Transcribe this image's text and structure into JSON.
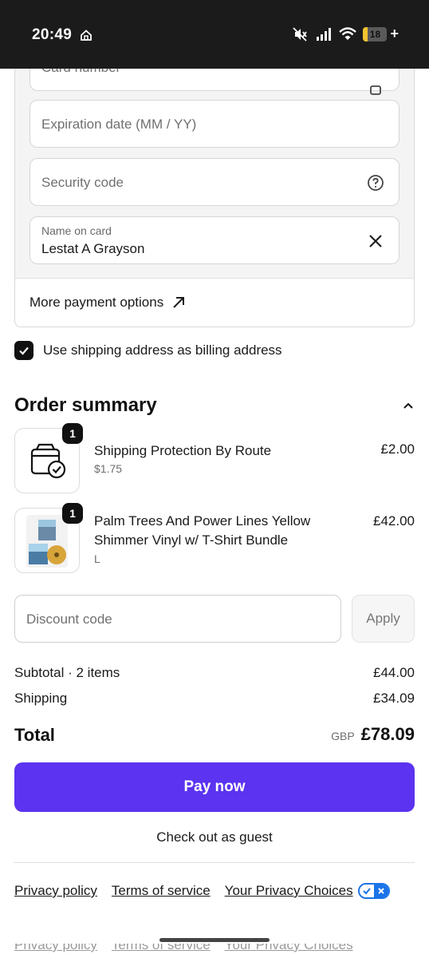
{
  "status_bar": {
    "time": "20:49",
    "battery": "18",
    "battery_level": 0.18,
    "plus": "+",
    "icons": [
      "home-icon",
      "mute-icon",
      "signal-icon",
      "wifi-icon",
      "battery-icon"
    ]
  },
  "card_form": {
    "card_number_placeholder": "Card number",
    "expiration_placeholder": "Expiration date (MM / YY)",
    "security_placeholder": "Security code",
    "name_label": "Name on card",
    "name_value": "Lestat A Grayson",
    "more_payment_options": "More payment options"
  },
  "billing": {
    "checked": true,
    "label": "Use shipping address as billing address"
  },
  "order_summary": {
    "title": "Order summary",
    "items": [
      {
        "qty": "1",
        "name": "Shipping Protection By Route",
        "sub": "$1.75",
        "price": "£2.00"
      },
      {
        "qty": "1",
        "name": "Palm Trees And Power Lines Yellow Shimmer Vinyl w/ T-Shirt Bundle",
        "sub": "L",
        "price": "£42.00"
      }
    ],
    "discount_placeholder": "Discount code",
    "apply_label": "Apply",
    "subtotal_label": "Subtotal · 2 items",
    "subtotal_value": "£44.00",
    "shipping_label": "Shipping",
    "shipping_value": "£34.09",
    "total_label": "Total",
    "total_currency": "GBP",
    "total_value": "£78.09"
  },
  "actions": {
    "pay_now": "Pay now",
    "guest": "Check out as guest"
  },
  "footer": {
    "privacy_policy": "Privacy policy",
    "terms": "Terms of service",
    "privacy_choices": "Your Privacy Choices"
  },
  "colors": {
    "accent": "#5b33f0",
    "status_bar": "#1b1b1b",
    "privacy_toggle": "#1a73e8"
  }
}
